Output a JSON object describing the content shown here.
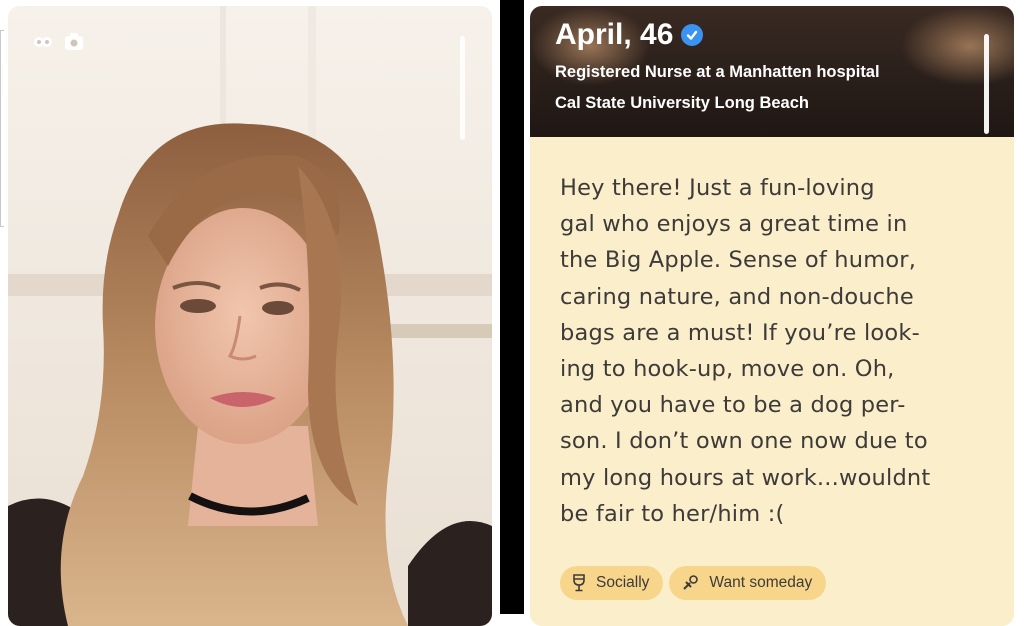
{
  "left_card": {
    "photo_icon": "person-photo",
    "story_icons": [
      "dots-icon",
      "camera-icon"
    ]
  },
  "profile": {
    "name_age": "April, 46",
    "verified_icon": "verified-check-icon",
    "occupation": "Registered Nurse at a Manhatten hospital",
    "school": "Cal State University Long Beach",
    "bio": "Hey there! Just a fun-loving\ngal who enjoys a great time in\nthe Big Apple. Sense of humor,\ncaring nature, and non-douche\nbags are a must! If you’re look-\ning to hook-up, move on. Oh,\nand you have to be a dog per-\nson. I don’t own one now due to\nmy long hours at work...wouldnt\nbe fair to her/him :(",
    "chips": [
      {
        "icon": "wine-glass-icon",
        "label": "Socially"
      },
      {
        "icon": "pacifier-icon",
        "label": "Want someday"
      }
    ]
  },
  "colors": {
    "card_background": "#fbeecb",
    "chip_background": "#f7d58a",
    "verified_blue": "#3a93f0",
    "text_dark": "#3d3b3a"
  }
}
